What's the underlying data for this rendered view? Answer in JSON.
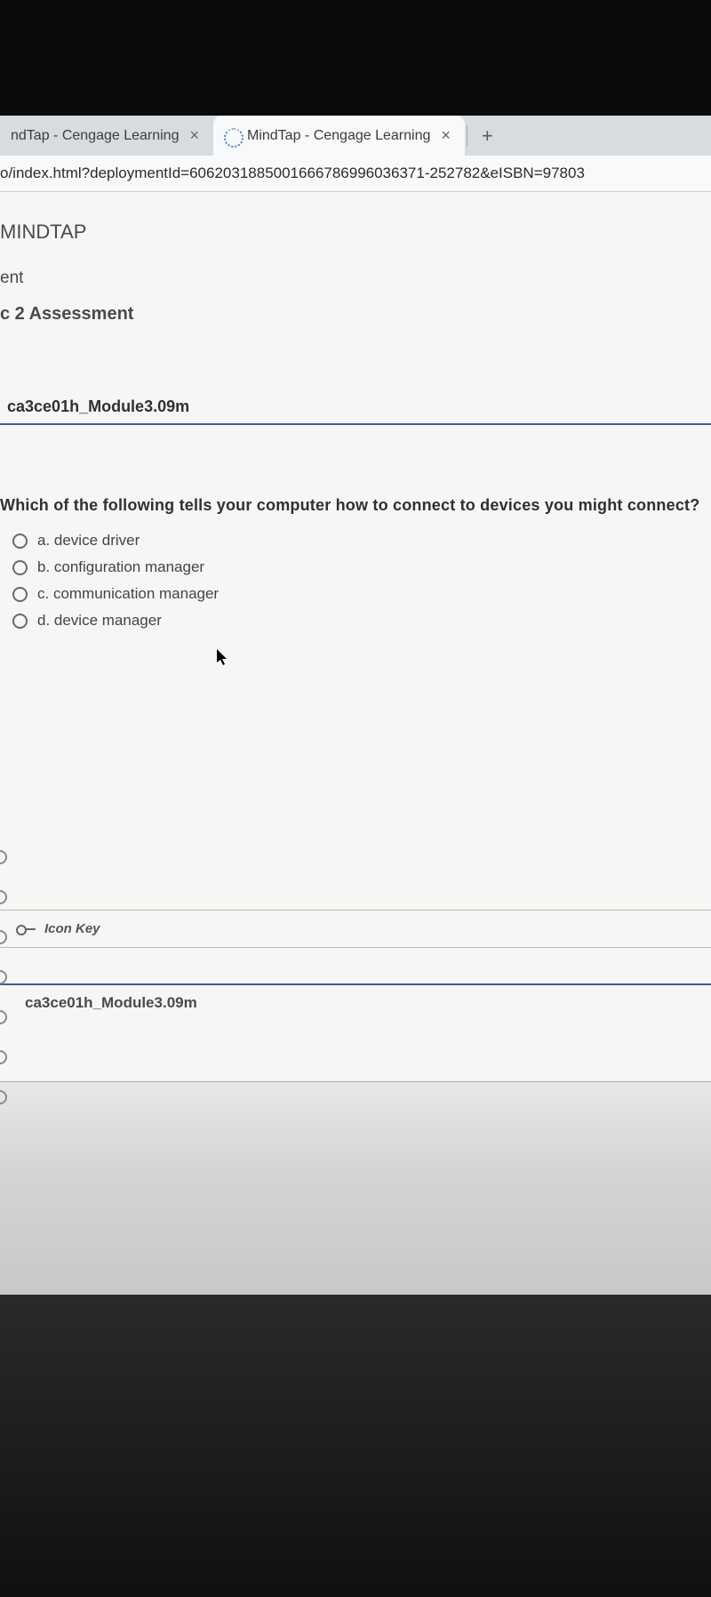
{
  "tabs": [
    {
      "title": "ndTap - Cengage Learning"
    },
    {
      "title": "MindTap - Cengage Learning"
    }
  ],
  "url": "o/index.html?deploymentId=6062031885001666786996036371-252782&eISBN=97803",
  "header": {
    "app": "MINDTAP",
    "crumb": "ent",
    "assessment": "c 2 Assessment"
  },
  "question": {
    "id_top": "ca3ce01h_Module3.09m",
    "text": "Which of the following tells your computer how to connect to devices you might connect?",
    "options": [
      "a. device driver",
      "b. configuration manager",
      "c. communication manager",
      "d. device manager"
    ],
    "icon_key": "Icon Key",
    "id_bottom": "ca3ce01h_Module3.09m"
  }
}
